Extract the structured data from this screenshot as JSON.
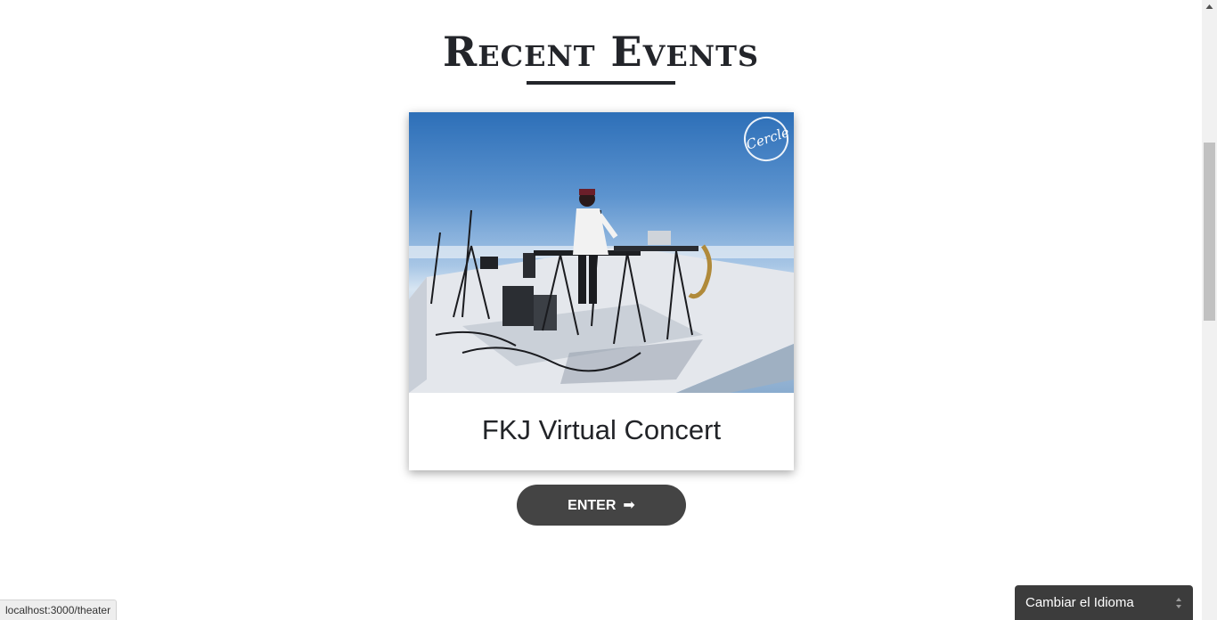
{
  "section": {
    "title": "Recent Events"
  },
  "event_card": {
    "title": "FKJ Virtual Concert",
    "image_logo": "Cercle",
    "button_label": "ENTER",
    "button_arrow": "➡"
  },
  "status_bar": {
    "url": "localhost:3000/theater"
  },
  "language_selector": {
    "label": "Cambiar el Idioma"
  },
  "colors": {
    "heading": "#23252a",
    "button_bg": "#444444",
    "selector_bg": "#3c3c3c"
  },
  "icons": {
    "enter_arrow": "right-arrow-icon",
    "select_chevrons": "select-chevrons-icon",
    "logo": "cercle-logo"
  }
}
